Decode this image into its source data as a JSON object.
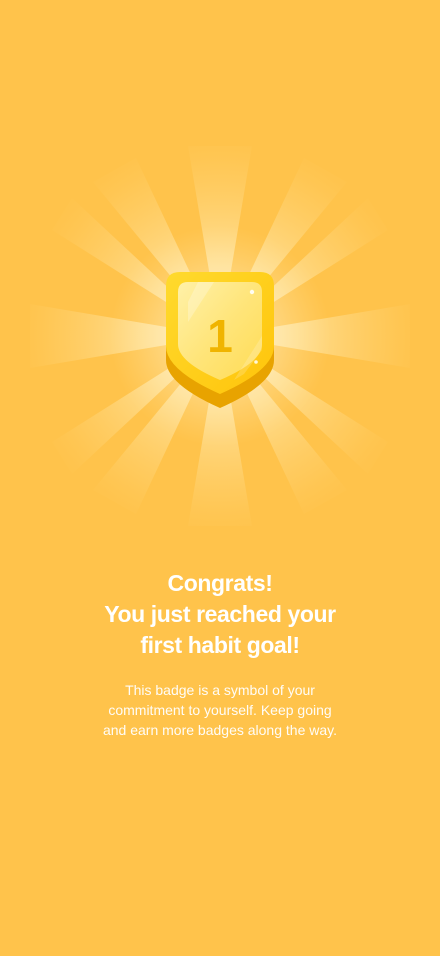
{
  "colors": {
    "background": "#FFC34B",
    "badge_rim": "#FFD218",
    "badge_face": "#FFE16B",
    "badge_shadow": "#E8A300",
    "badge_number": "#F0B400",
    "text": "#FFFFFF"
  },
  "badge": {
    "icon": "shield-badge-icon",
    "number": "1"
  },
  "headline": {
    "line1": "Congrats!",
    "line2": "You just reached your",
    "line3": "first habit goal!"
  },
  "body": {
    "line1": "This badge is a symbol of your",
    "line2": "commitment to yourself. Keep going",
    "line3": "and earn more badges along the way."
  }
}
